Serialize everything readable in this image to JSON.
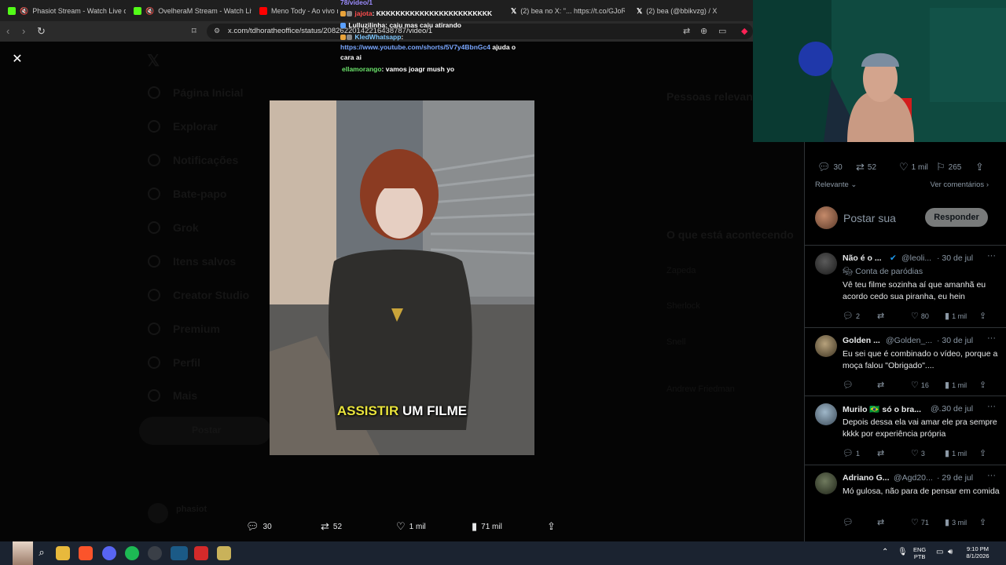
{
  "browser": {
    "tabs": [
      {
        "label": "Phasiot Stream - Watch Live on",
        "color": "#53fc18"
      },
      {
        "label": "OvelheraM Stream - Watch Live",
        "color": "#53fc18"
      },
      {
        "label": "Meno Tody - Ao vivo na ...",
        "color": "#ff0000"
      },
      {
        "label": "(2) bea no X: \"... https://t.co/GJoR",
        "color": "#ffffff"
      },
      {
        "label": "(2) bea (@bbikvzg) / X",
        "color": "#ffffff"
      }
    ],
    "url": "x.com/tdhoratheoffice/status/20826220142216438787/video/1"
  },
  "chat": {
    "lines": [
      {
        "user": "",
        "text": "78/video/1",
        "user_color": "#9b8cff"
      },
      {
        "user": "jajota",
        "text": ": KKKKKKKKKKKKKKKKKKKKKKKK",
        "user_color": "#ff4d4d"
      },
      {
        "user": "Lulluzilinha",
        "text": ": caiu mas caiu atirando",
        "user_color": "#ffffff"
      },
      {
        "user": "KledWhatsapp",
        "text": ":",
        "user_color": "#7ec8ff"
      },
      {
        "user": "",
        "text": "https://www.youtube.com/shorts/5V7y4BbnGc4",
        "user_color": "#7aa7ff"
      },
      {
        "user": "",
        "text": "ajuda o",
        "user_color": "#ffffff"
      },
      {
        "user": "",
        "text": "cara ai",
        "user_color": "#ffffff"
      },
      {
        "user": "ellamorango",
        "text": ": vamos joagr mush yo",
        "user_color": "#6be36b"
      }
    ]
  },
  "video": {
    "caption_highlight": "ASSISTIR",
    "caption_rest": "UM FILME"
  },
  "post_actions": {
    "replies": "30",
    "reposts": "52",
    "likes": "1 mil",
    "views": "71 mil"
  },
  "panel": {
    "stats": {
      "replies": "30",
      "reposts": "52",
      "likes": "1 mil",
      "bookmarks": "265"
    },
    "sort_label": "Relevante",
    "see_comments": "Ver comentários",
    "compose_placeholder": "Postar sua",
    "reply_button": "Responder",
    "replies": [
      {
        "name": "Não é o ...",
        "handle": "@leoli...",
        "date": "· 30 de jul",
        "sub": "Conta de paródias",
        "text": "Vê teu filme sozinha aí que amanhã eu acordo cedo sua piranha, eu hein",
        "stats": {
          "replies": "2",
          "reposts": "",
          "likes": "80",
          "views": "1 mil"
        }
      },
      {
        "name": "Golden ...",
        "handle": "@Golden_...",
        "date": "· 30 de jul",
        "sub": "",
        "text": "Eu sei que é combinado o vídeo, porque a moça falou \"Obrigado\"....",
        "stats": {
          "replies": "",
          "reposts": "",
          "likes": "16",
          "views": "1 mil"
        }
      },
      {
        "name": "Murilo 🇧🇷 só o bra...",
        "handle": "@...",
        "date": "· 30 de jul",
        "sub": "",
        "text": "Depois dessa ela vai amar ele pra sempre kkkk por experiência própria",
        "stats": {
          "replies": "1",
          "reposts": "",
          "likes": "3",
          "views": "1 mil"
        }
      },
      {
        "name": "Adriano G...",
        "handle": "@Agd20...",
        "date": "· 29 de jul",
        "sub": "",
        "text": "Mó gulosa, não para de pensar em comida",
        "stats": {
          "replies": "",
          "reposts": "",
          "likes": "71",
          "views": "3 mil"
        }
      }
    ]
  },
  "background_page": {
    "nav": [
      "Página Inicial",
      "Explorar",
      "Notificações",
      "Bate-papo",
      "Grok",
      "Itens salvos",
      "Creator Studio",
      "Premium",
      "Perfil",
      "Mais"
    ],
    "post_button": "Postar",
    "profile_name": "phasiot",
    "right_titles": [
      "Pessoas relevantes",
      "O que está acontecendo"
    ],
    "right_items": [
      "Zapeda",
      "Sherlock",
      "Snell",
      "Andrew Friedman"
    ]
  },
  "taskbar": {
    "lang_top": "ENG",
    "lang_bottom": "PTB",
    "time": "9:10 PM",
    "date": "8/1/2026"
  }
}
